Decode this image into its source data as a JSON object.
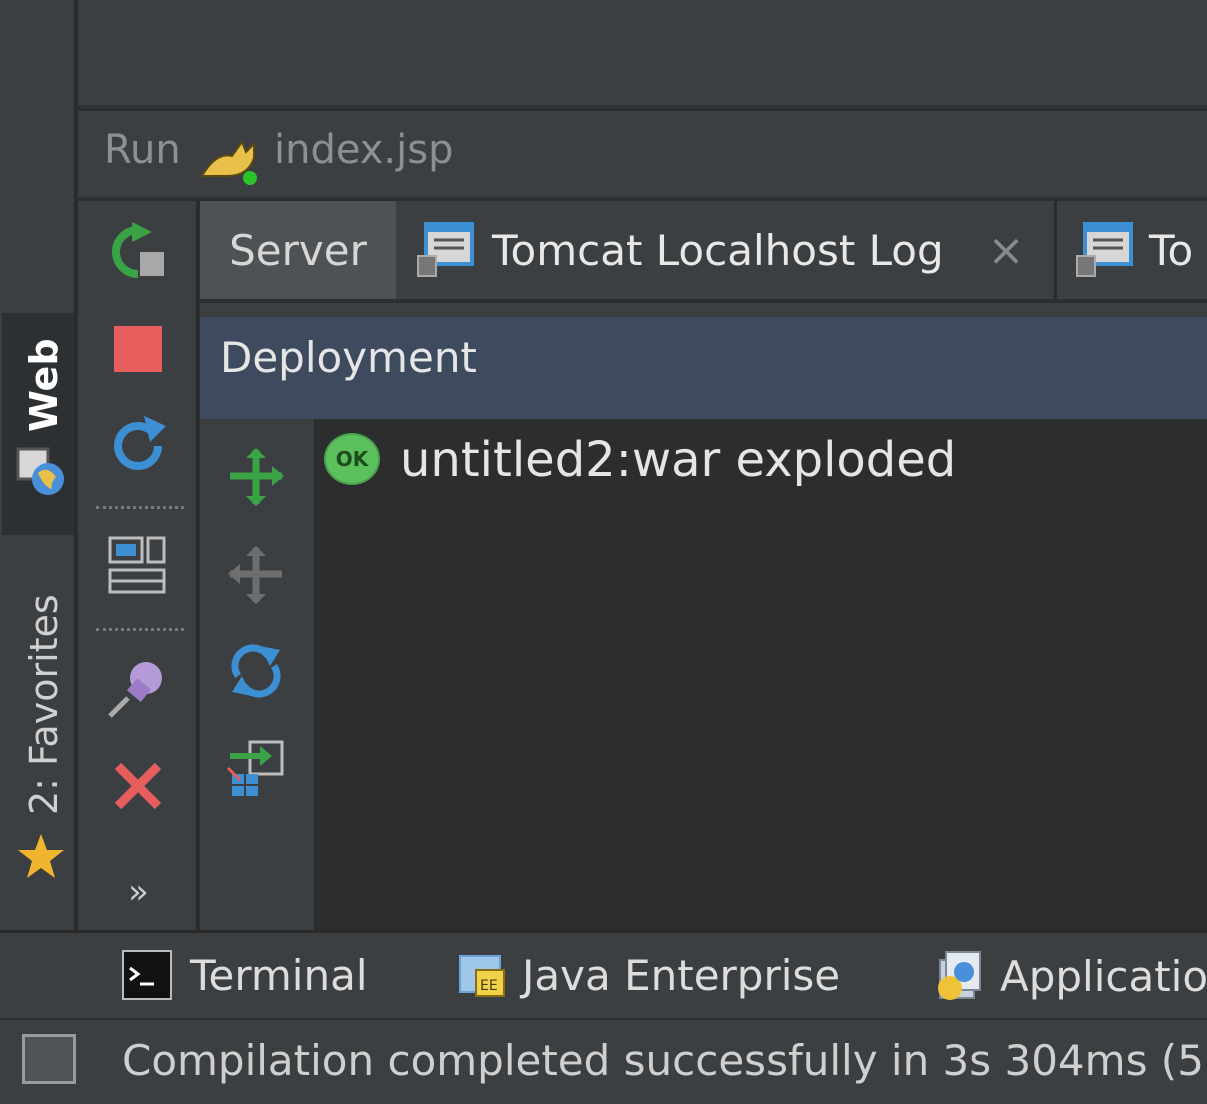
{
  "left_strip": {
    "web_label": "Web",
    "favorites_label": "2: Favorites"
  },
  "run_header": {
    "run_label": "Run",
    "config_name": "index.jsp"
  },
  "tabs": [
    {
      "label": "Server"
    },
    {
      "label": "Tomcat Localhost Log",
      "close": "×"
    },
    {
      "label": "To"
    }
  ],
  "toolbar": {
    "more": "»"
  },
  "deployment": {
    "header": "Deployment",
    "ok_badge": "OK",
    "artifact": "untitled2:war exploded"
  },
  "bottom_tools": {
    "terminal": "Terminal",
    "java_enterprise": "Java Enterprise",
    "application": "Applicatio"
  },
  "status": {
    "message": "Compilation completed successfully in 3s 304ms (5"
  },
  "colors": {
    "background": "#2b2d2f",
    "panel": "#3c3f41",
    "selection": "#3e4b5e",
    "ok": "#5cc05c",
    "stop": "#e55d5d",
    "green_arrow": "#3aa346",
    "blue_arrow": "#3d8fd4"
  }
}
